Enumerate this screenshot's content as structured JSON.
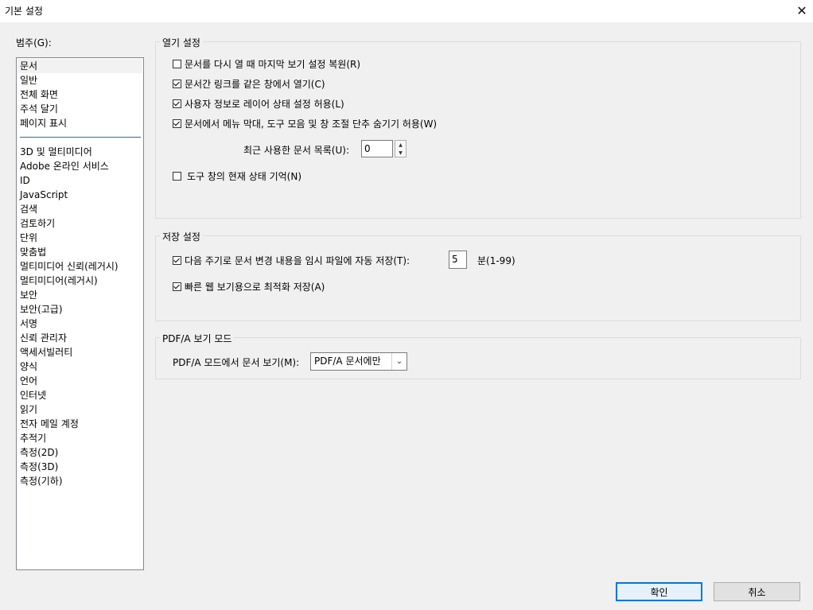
{
  "window": {
    "title": "기본 설정",
    "close_glyph": "✕"
  },
  "categories": {
    "label": "범주(G):",
    "items_top": [
      "문서",
      "일반",
      "전체 화면",
      "주석 달기",
      "페이지 표시"
    ],
    "items_bottom": [
      "3D 및 멀티미디어",
      "Adobe 온라인 서비스",
      "ID",
      "JavaScript",
      "검색",
      "검토하기",
      "단위",
      "맞춤법",
      "멀티미디어 신뢰(레거시)",
      "멀티미디어(레거시)",
      "보안",
      "보안(고급)",
      "서명",
      "신뢰 관리자",
      "액세서빌러티",
      "양식",
      "언어",
      "인터넷",
      "읽기",
      "전자 메일 계정",
      "추적기",
      "측정(2D)",
      "측정(3D)",
      "측정(기하)"
    ],
    "selected": "문서"
  },
  "open_settings": {
    "title": "열기 설정",
    "restore_view": {
      "label": "문서를 다시 열 때 마지막 보기 설정 복원(R)",
      "checked": false
    },
    "open_links_same_window": {
      "label": "문서간 링크를 같은 창에서 열기(C)",
      "checked": true
    },
    "allow_layer_state": {
      "label": "사용자 정보로 레이어 상태 설정 허용(L)",
      "checked": true
    },
    "allow_hide_menu": {
      "label": "문서에서 메뉴 막대, 도구 모음 및 창 조절 단추 숨기기 허용(W)",
      "checked": true
    },
    "recent_docs_label": "최근 사용한 문서 목록(U):",
    "recent_docs_value": "0",
    "remember_tool_pane": {
      "label": "도구 창의 현재 상태 기억(N)",
      "checked": false
    }
  },
  "save_settings": {
    "title": "저장 설정",
    "autosave": {
      "label": "다음 주기로 문서 변경 내용을 임시 파일에 자동 저장(T):",
      "checked": true
    },
    "autosave_value": "5",
    "autosave_unit": "분(1-99)",
    "fast_web_view": {
      "label": "빠른 웹 보기용으로 최적화 저장(A)",
      "checked": true
    }
  },
  "pdfa": {
    "title": "PDF/A 보기 모드",
    "label": "PDF/A 모드에서 문서 보기(M):",
    "selected": "PDF/A 문서에만"
  },
  "buttons": {
    "ok": "확인",
    "cancel": "취소"
  },
  "colors": {
    "accent": "#0078d7",
    "separator": "#1f6fa6"
  }
}
